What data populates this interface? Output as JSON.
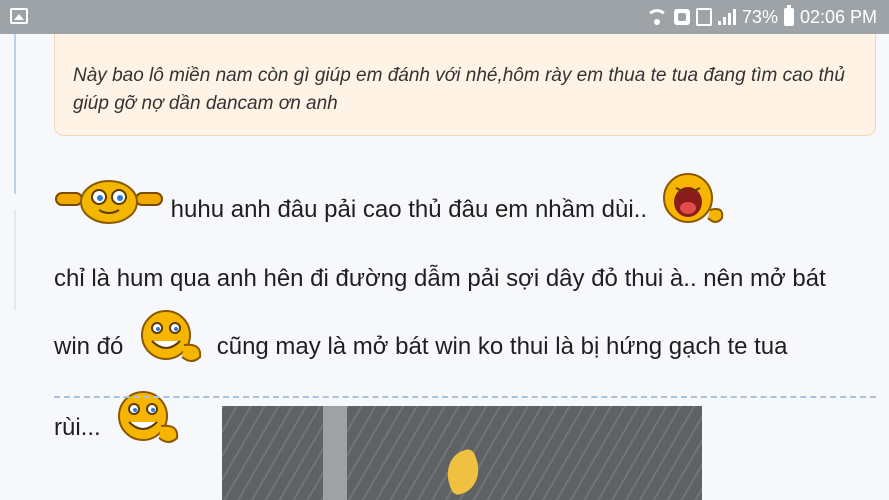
{
  "status_bar": {
    "battery": "73%",
    "time": "02:06 PM",
    "icons": [
      "gallery-icon",
      "wifi-icon",
      "nfc-icon",
      "sim-icon",
      "signal-icon",
      "battery-icon"
    ]
  },
  "quote": {
    "text": "Này bao lô miền nam còn gì giúp em đánh với nhé,hôm rày em thua te tua đang tìm cao thủ giúp gỡ nợ dần dancam ơn anh"
  },
  "post": {
    "line1": "huhu anh đâu pải cao thủ đâu em nhầm dùi..",
    "line2": "chỉ là hum qua anh hên đi đường dẫm pải sợi dây đỏ thui à.. nên mở bát",
    "line3a": "win đó",
    "line3b": "cũng may là mở bát win ko thui là bị hứng gạch te tua",
    "line4": "rùi..."
  },
  "colors": {
    "status_bar_bg": "#9ea3a8",
    "quote_bg": "#fff3e6",
    "text": "#1f1f1f",
    "divider": "#a9c3dc"
  },
  "emoji_icons": [
    "cheer-emoji-icon",
    "shock-emoji-icon",
    "smile-emoji-icon",
    "smile-emoji-icon"
  ]
}
